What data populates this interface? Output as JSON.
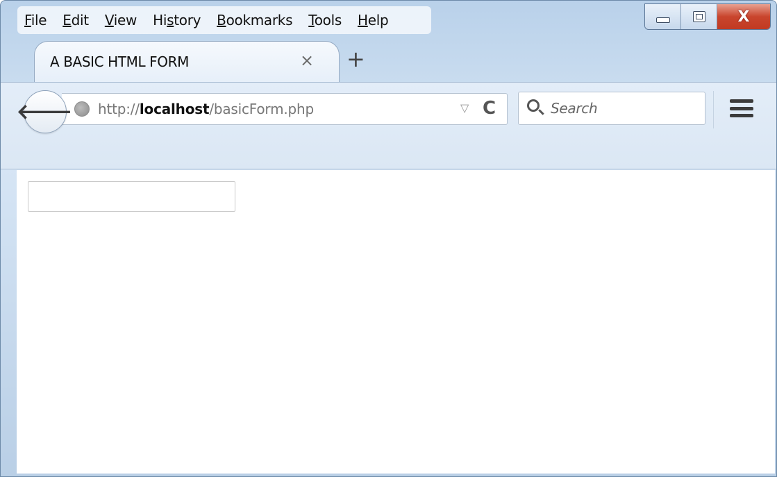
{
  "menubar": {
    "items": [
      {
        "pre": "",
        "ul": "F",
        "post": "ile"
      },
      {
        "pre": "",
        "ul": "E",
        "post": "dit"
      },
      {
        "pre": "",
        "ul": "V",
        "post": "iew"
      },
      {
        "pre": "Hi",
        "ul": "s",
        "post": "tory"
      },
      {
        "pre": "",
        "ul": "B",
        "post": "ookmarks"
      },
      {
        "pre": "",
        "ul": "T",
        "post": "ools"
      },
      {
        "pre": "",
        "ul": "H",
        "post": "elp"
      }
    ]
  },
  "window_controls": {
    "close_glyph": "X"
  },
  "tab": {
    "title": "A BASIC HTML FORM",
    "close_glyph": "×",
    "new_tab_glyph": "+"
  },
  "navbar": {
    "url_prefix": "http://",
    "url_host": "localhost",
    "url_path": "/basicForm.php",
    "dropdown_glyph": "▽",
    "reload_glyph": "C",
    "back_glyph": "🡐",
    "search_placeholder": "Search"
  },
  "form": {
    "text_input_value": ""
  },
  "colors": {
    "close_button": "#c9452d",
    "toolbar_bg": "#dbe7f4",
    "window_frame": "#b9d1ea"
  }
}
